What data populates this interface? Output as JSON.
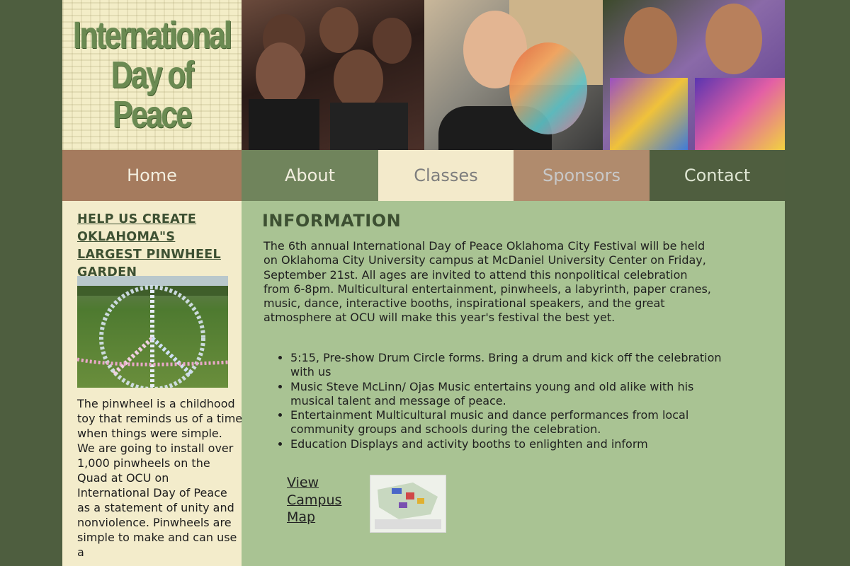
{
  "logo": {
    "line1": "International",
    "line2": "Day of",
    "line3": "Peace"
  },
  "nav": {
    "home": "Home",
    "about": "About",
    "classes": "Classes",
    "sponsors": "Sponsors",
    "contact": "Contact"
  },
  "sidebar": {
    "title": "Help us create Oklahoma\"s largest pinwheel garden",
    "text": "The pinwheel is a childhood toy that reminds us of a time when things were simple. We are going to install over 1,000 pinwheels on the Quad at OCU on International Day of Peace as a statement of unity and nonviolence. Pinwheels are simple to make and can use a"
  },
  "main": {
    "title": "Information",
    "paragraph": "The 6th annual International Day of Peace Oklahoma City Festival will be held on Oklahoma City University campus at McDaniel University Center on Friday, September 21st. All ages are invited to attend this nonpolitical celebration from 6-8pm. Multicultural entertainment, pinwheels, a labyrinth, paper cranes, music, dance, interactive booths, inspirational speakers, and the great atmosphere at OCU will make this year's festival the best yet.",
    "bullets": [
      "5:15, Pre-show Drum Circle forms. Bring a drum and kick off the celebration with us",
      "Music Steve McLinn/ Ojas Music entertains young and old alike with his musical talent and message of peace.",
      "Entertainment Multicultural music and dance performances from local community groups and schools during the celebration.",
      "Education Displays and activity booths to enlighten and inform"
    ],
    "map_link": "View Campus Map"
  }
}
